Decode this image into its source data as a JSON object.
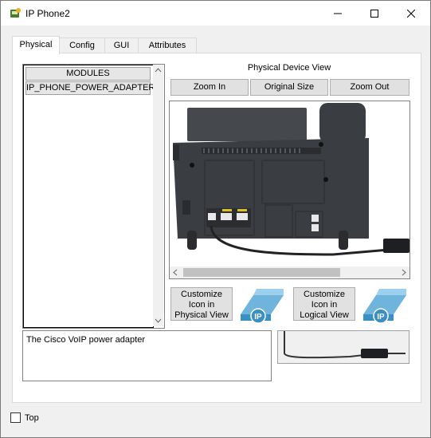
{
  "window": {
    "title": "IP Phone2",
    "controls": [
      "minimize",
      "maximize",
      "close"
    ]
  },
  "tabs": [
    {
      "label": "Physical",
      "active": true
    },
    {
      "label": "Config",
      "active": false
    },
    {
      "label": "GUI",
      "active": false
    },
    {
      "label": "Attributes",
      "active": false
    }
  ],
  "modules": {
    "header": "MODULES",
    "items": [
      "IP_PHONE_POWER_ADAPTER"
    ]
  },
  "device_view": {
    "title": "Physical Device View",
    "zoom_in": "Zoom In",
    "original_size": "Original Size",
    "zoom_out": "Zoom Out"
  },
  "customize": {
    "physical_label": "Customize Icon in Physical View",
    "logical_label": "Customize Icon in Logical View",
    "physical_lines": [
      "Customize",
      "Icon in",
      "Physical View"
    ],
    "logical_lines": [
      "Customize",
      "Icon in",
      "Logical View"
    ]
  },
  "description": "The Cisco VoIP power adapter",
  "footer": {
    "top_label": "Top",
    "top_checked": false
  },
  "colors": {
    "phone_body": "#3a3d42",
    "ip_icon_blue": "#3a8fc5"
  }
}
